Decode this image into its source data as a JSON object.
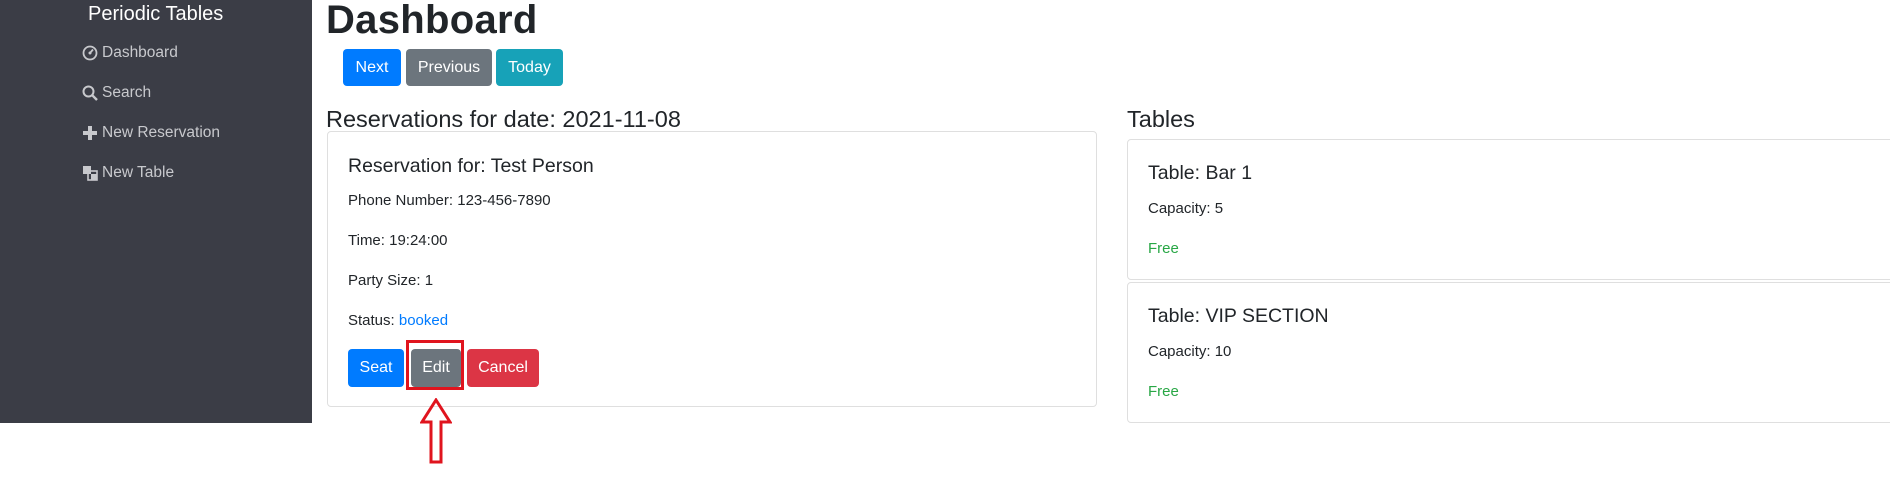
{
  "sidebar": {
    "brand": "Periodic Tables",
    "items": [
      {
        "label": "Dashboard",
        "icon": "dashboard-icon"
      },
      {
        "label": "Search",
        "icon": "search-icon"
      },
      {
        "label": "New Reservation",
        "icon": "plus-icon"
      },
      {
        "label": "New Table",
        "icon": "table-icon"
      }
    ]
  },
  "header": {
    "title": "Dashboard",
    "buttons": {
      "next": "Next",
      "previous": "Previous",
      "today": "Today"
    }
  },
  "reservations": {
    "heading": "Reservations for date: 2021-11-08",
    "cards": [
      {
        "title": "Reservation for: Test Person",
        "phone": "Phone Number: 123-456-7890",
        "time": "Time: 19:24:00",
        "party_size": "Party Size: 1",
        "status_label": "Status: ",
        "status_value": "booked",
        "buttons": {
          "seat": "Seat",
          "edit": "Edit",
          "cancel": "Cancel"
        }
      }
    ]
  },
  "tables": {
    "heading": "Tables",
    "cards": [
      {
        "title": "Table: Bar 1",
        "capacity": "Capacity: 5",
        "status": "Free"
      },
      {
        "title": "Table: VIP SECTION",
        "capacity": "Capacity: 10",
        "status": "Free"
      }
    ]
  },
  "colors": {
    "sidebar_bg": "#3b3d46",
    "primary": "#007bff",
    "secondary": "#6c757d",
    "info": "#17a2b8",
    "danger": "#dc3545",
    "success": "#28a745",
    "annotation": "#e0141e"
  }
}
